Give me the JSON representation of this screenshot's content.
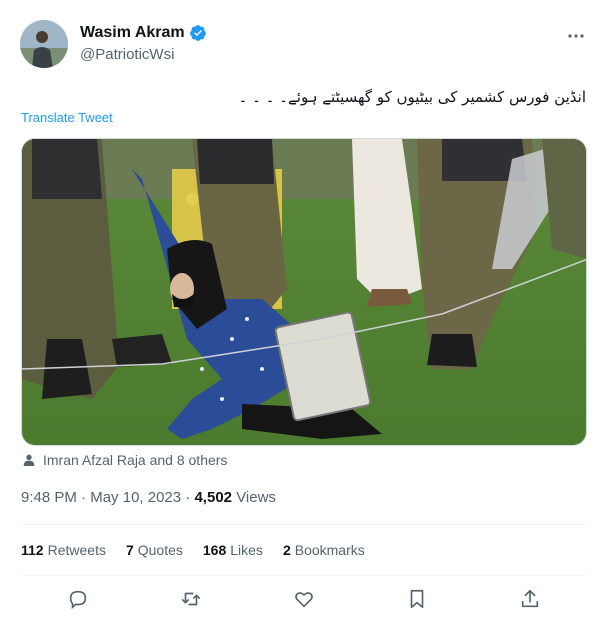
{
  "author": {
    "display_name": "Wasim Akram",
    "handle": "@PatrioticWsi"
  },
  "tweet": {
    "text": "انڈین فورس کشمیر کی بیٹیوں کو گھسیٹتے ہوئے۔ ۔ ۔ ۔",
    "translate_label": "Translate Tweet"
  },
  "tagged": {
    "text": "Imran Afzal Raja and 8 others"
  },
  "meta": {
    "time": "9:48 PM",
    "date": "May 10, 2023",
    "views_count": "4,502",
    "views_label": "Views"
  },
  "stats": [
    {
      "count": "112",
      "label": "Retweets"
    },
    {
      "count": "7",
      "label": "Quotes"
    },
    {
      "count": "168",
      "label": "Likes"
    },
    {
      "count": "2",
      "label": "Bookmarks"
    }
  ],
  "colors": {
    "link": "#1d9bf0",
    "secondary_text": "#536471",
    "verified": "#1d9bf0"
  },
  "icons": [
    "verified-badge-icon",
    "more-options-icon",
    "person-tag-icon",
    "reply-icon",
    "retweet-icon",
    "like-icon",
    "bookmark-icon",
    "share-icon"
  ]
}
